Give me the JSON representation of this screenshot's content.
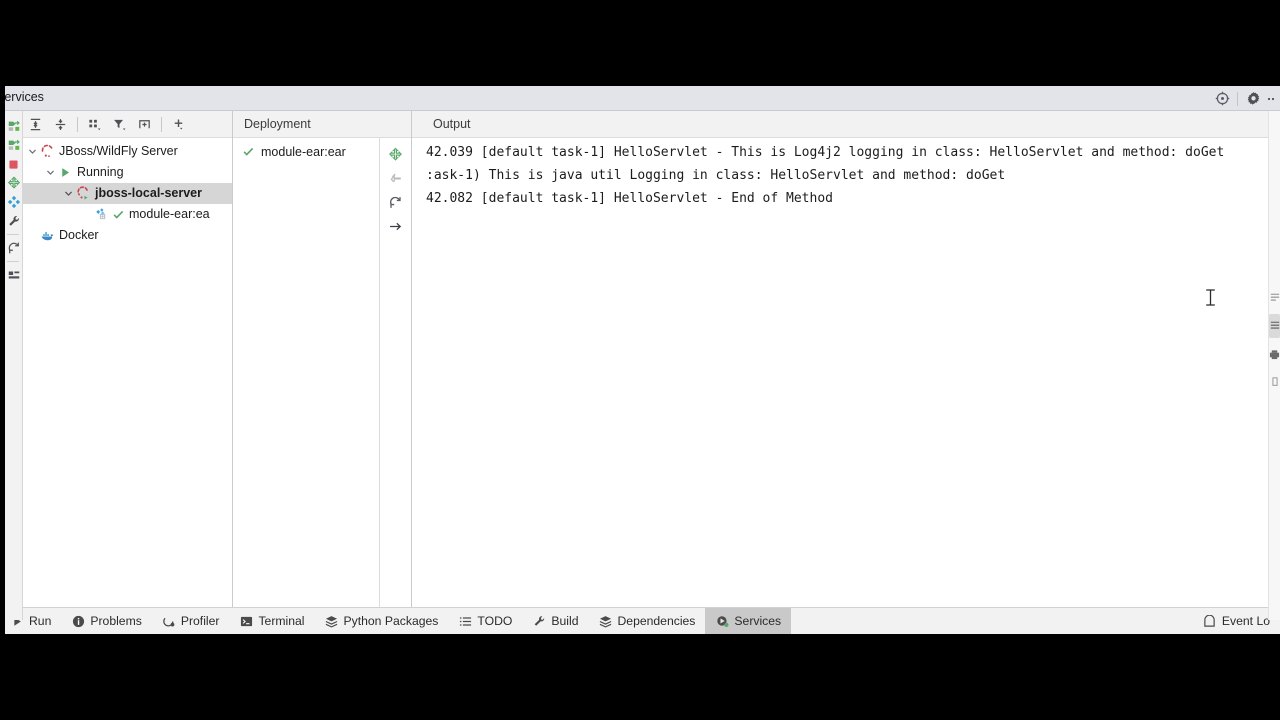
{
  "tool_window": {
    "title": "Services",
    "header_actions": [
      {
        "name": "locate-icon",
        "tooltip": "Locate"
      },
      {
        "name": "gear-icon",
        "tooltip": "Settings"
      },
      {
        "name": "more-icon",
        "tooltip": "More"
      }
    ]
  },
  "left_rail": {
    "buttons": [
      {
        "name": "rerun-icon",
        "label": "Rerun"
      },
      {
        "name": "rerun-debug-icon",
        "label": "Rerun Debug"
      },
      {
        "name": "stop-icon",
        "label": "Stop"
      },
      {
        "name": "deploy-all-icon",
        "label": "Deploy All"
      },
      {
        "name": "edit-configuration-icon",
        "label": "Edit Configuration"
      },
      {
        "name": "settings-wrench-icon",
        "label": "Settings"
      },
      {
        "name": "restart-icon",
        "label": "Restart"
      },
      {
        "name": "layout-icon",
        "label": "Layout"
      }
    ]
  },
  "tree_panel": {
    "toolbar": [
      {
        "name": "expand-all-icon",
        "label": "Expand All"
      },
      {
        "name": "collapse-all-icon",
        "label": "Collapse All"
      },
      {
        "name": "group-by-icon",
        "label": "Group By"
      },
      {
        "name": "filter-icon",
        "label": "Filter"
      },
      {
        "name": "add-tab-icon",
        "label": "Add Tab"
      },
      {
        "name": "add-icon",
        "label": "Add Service"
      }
    ],
    "items": [
      {
        "label": "JBoss/WildFly Server",
        "icon": "jboss-icon",
        "indent": 0,
        "expanded": true,
        "bold": false,
        "selected": false
      },
      {
        "label": "Running",
        "icon": "run-green-icon",
        "indent": 1,
        "expanded": true,
        "bold": false,
        "selected": false
      },
      {
        "label": "jboss-local-server",
        "icon": "jboss-run-icon",
        "indent": 2,
        "expanded": true,
        "bold": true,
        "selected": true
      },
      {
        "label": "module-ear:ea",
        "icon": "artifact-icon",
        "indent": 3,
        "expanded": false,
        "bold": false,
        "selected": false
      },
      {
        "label": "Docker",
        "icon": "docker-icon",
        "indent": 0,
        "expanded": false,
        "bold": false,
        "selected": false
      }
    ]
  },
  "deployment_panel": {
    "header": "Deployment",
    "rows": [
      {
        "label": "module-ear:ear",
        "status": "ok"
      }
    ],
    "actions": [
      {
        "name": "deploy-icon",
        "label": "Deploy",
        "enabled": true
      },
      {
        "name": "undeploy-icon",
        "label": "Undeploy",
        "enabled": false
      },
      {
        "name": "redeploy-icon",
        "label": "Redeploy",
        "enabled": true
      },
      {
        "name": "jump-to-icon",
        "label": "Jump to Source",
        "enabled": true
      }
    ]
  },
  "output_panel": {
    "header": "Output",
    "lines": [
      "42.039 [default task-1] HelloServlet - This is Log4j2 logging in class: HelloServlet and method: doGet",
      ":ask-1) This is java util Logging in class: HelloServlet and method: doGet",
      "42.082 [default task-1] HelloServlet - End of Method"
    ],
    "right_rail": [
      {
        "name": "soft-wrap-icon",
        "label": "Soft-Wrap",
        "active": false
      },
      {
        "name": "scroll-to-end-icon",
        "label": "Scroll to End",
        "active": true
      },
      {
        "name": "print-icon",
        "label": "Print",
        "active": false
      },
      {
        "name": "clear-all-icon",
        "label": "Clear All",
        "active": false
      }
    ]
  },
  "status_bar": {
    "items": [
      {
        "label": "Run",
        "icon": "run-icon",
        "active": false
      },
      {
        "label": "Problems",
        "icon": "problems-icon",
        "active": false
      },
      {
        "label": "Profiler",
        "icon": "profiler-icon",
        "active": false
      },
      {
        "label": "Terminal",
        "icon": "terminal-icon",
        "active": false
      },
      {
        "label": "Python Packages",
        "icon": "packages-icon",
        "active": false
      },
      {
        "label": "TODO",
        "icon": "todo-icon",
        "active": false
      },
      {
        "label": "Build",
        "icon": "build-icon",
        "active": false
      },
      {
        "label": "Dependencies",
        "icon": "dependencies-icon",
        "active": false
      },
      {
        "label": "Services",
        "icon": "services-icon",
        "active": true
      }
    ],
    "right": {
      "label": "Event Lo",
      "icon": "event-log-icon"
    }
  },
  "colors": {
    "accent_green": "#59a869",
    "error_red": "#db5860",
    "panel_bg": "#f2f2f2",
    "header_bg": "#e2e4ea",
    "selection": "#d6d6d6",
    "text": "#1d1d1d"
  }
}
